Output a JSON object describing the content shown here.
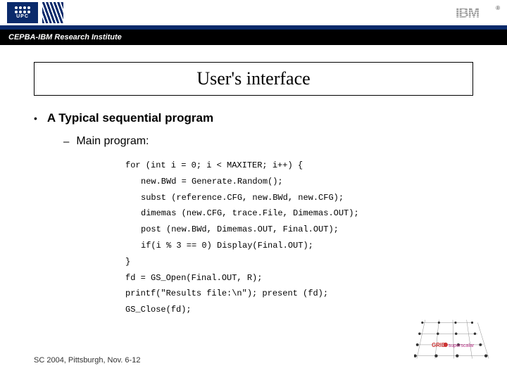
{
  "header": {
    "upc_label": "UPC",
    "ibm_label": "IBM",
    "registered": "®",
    "institute": "CEPBA-IBM Research Institute"
  },
  "slide": {
    "title": "User's interface",
    "bullet1": "A Typical sequential program",
    "sub1": "Main program:",
    "code": {
      "l1": "for (int i = 0; i < MAXITER; i++) {",
      "l2": "new.BWd = Generate.Random();",
      "l3": "subst (reference.CFG, new.BWd, new.CFG);",
      "l4": "dimemas (new.CFG, trace.File, Dimemas.OUT);",
      "l5": "post (new.BWd, Dimemas.OUT, Final.OUT);",
      "l6": "if(i % 3 == 0) Display(Final.OUT);",
      "l7": "}",
      "l8": "fd = GS_Open(Final.OUT, R);",
      "l9": "printf(\"Results file:\\n\"); present (fd);",
      "l10": "GS_Close(fd);"
    }
  },
  "footer": "SC 2004, Pittsburgh, Nov. 6-12",
  "grid_logo_text": "GRID superscalar"
}
